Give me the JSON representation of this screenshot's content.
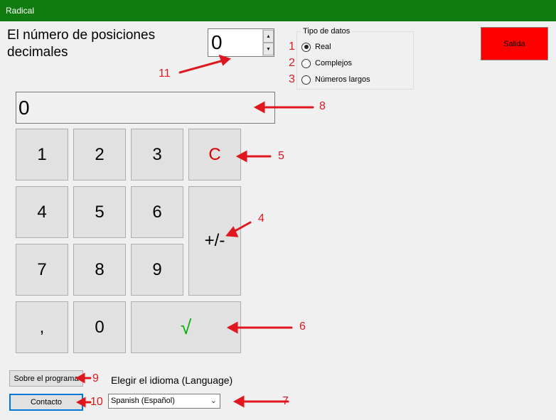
{
  "window": {
    "title": "Radical"
  },
  "decimals": {
    "label": "El número de posiciones decimales",
    "value": "0"
  },
  "data_type": {
    "title": "Tipo de datos",
    "options": [
      {
        "label": "Real",
        "checked": true
      },
      {
        "label": "Complejos",
        "checked": false
      },
      {
        "label": "Números largos",
        "checked": false
      }
    ]
  },
  "exit_button": {
    "label": "Salida",
    "color": "#ff0000"
  },
  "display": {
    "value": "0"
  },
  "keypad": {
    "k1": "1",
    "k2": "2",
    "k3": "3",
    "clear": "C",
    "k4": "4",
    "k5": "5",
    "k6": "6",
    "sign": "+/-",
    "k7": "7",
    "k8": "8",
    "k9": "9",
    "comma": ",",
    "k0": "0",
    "sqrt": "√"
  },
  "footer": {
    "about_button": "Sobre el programa",
    "contact_button": "Contacto",
    "language_label": "Elegir el idioma (Language)",
    "language_selected": "Spanish (Español)"
  },
  "annotations": [
    "1",
    "2",
    "3",
    "4",
    "5",
    "6",
    "7",
    "8",
    "9",
    "10",
    "11"
  ],
  "colors": {
    "titlebar": "#107c10",
    "annotation": "#e0171f",
    "sqrt": "#00b000",
    "clear": "#e00000"
  }
}
